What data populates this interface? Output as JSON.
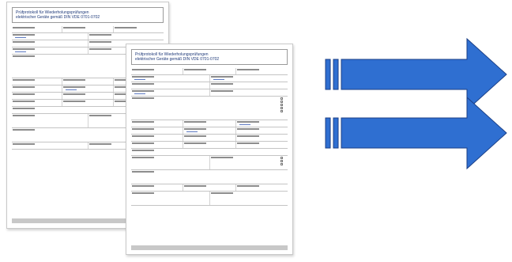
{
  "documents": [
    {
      "title_line_1": "Prüfprotokoll für Wiederholungsprüfungen",
      "title_line_2": "elektrischer Geräte gemäß DIN VDE 0701-0702"
    },
    {
      "title_line_1": "Prüfprotokoll für Wiederholungsprüfungen",
      "title_line_2": "elektrischer Geräte gemäß DIN VDE 0701-0702"
    }
  ],
  "colors": {
    "arrow_fill": "#2f6fd1",
    "arrow_stroke": "#1b3f86",
    "title_text": "#1f3a7a"
  },
  "icons": [
    "arrow-right-icon",
    "arrow-right-icon"
  ]
}
